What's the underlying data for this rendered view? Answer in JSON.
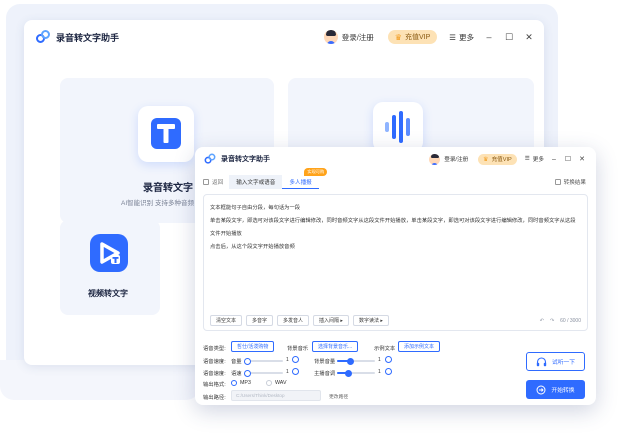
{
  "app": {
    "title": "录音转文字助手"
  },
  "header": {
    "login_label": "登录/注册",
    "vip_label": "充值VIP",
    "more_label": "更多",
    "minimize": "–",
    "maximize": "☐",
    "close": "✕"
  },
  "back_window": {
    "cards": [
      {
        "title": "录音转文字",
        "subtitle": "AI智能识别 支持多种音频"
      },
      {
        "title": ""
      },
      {
        "title": "视频转文字"
      }
    ]
  },
  "front_window": {
    "tabs": {
      "back_label": "返回",
      "input_tab": "输入文字或语音",
      "multi_tab": "多人播报",
      "badge": "实现可购",
      "right_label": "转换结果"
    },
    "editor": {
      "lines": [
        "文本框能句子自由分段，每句话为一段",
        "单击某段文字，即选可对该段文字进行编辑修改，同时音频文字从这段文件开始播放，单击某段文字，即选可对该段文字进行编辑修改，同时音频文字从这段",
        "文件开始播放",
        "点击后，从这个段文字开始播放音频"
      ],
      "tools": [
        "清空文本",
        "多音字",
        "多发音人",
        "插入间隔 ▸",
        "数字读法 ▸"
      ],
      "undo": "↶",
      "redo": "↷",
      "counter": "60 / 3000"
    },
    "settings": {
      "voice_type_label": "语音类型:",
      "voice_type_button": "哲仕/活泼购物",
      "bg_music_label": "背景音乐",
      "bg_music_button": "选择背景音乐...",
      "sample_label": "示例文本",
      "sample_button": "添加示例文本",
      "speed_label": "语音速度:",
      "volume_label": "音量",
      "volume_value": "1",
      "volume_level": 0.05,
      "bg_volume_label": "背景音量",
      "bg_volume_value": "1",
      "bg_volume_level": 0.35,
      "speed2_label": "语音速度:",
      "rate_label": "语速",
      "rate_value": "1",
      "rate_level": 0.05,
      "main_volume_label": "主播音调",
      "main_volume_value": "1",
      "main_volume_level": 0.3,
      "format_label": "输出格式:",
      "format_mp3": "MP3",
      "format_wav": "WAV",
      "format_selected": "MP3",
      "path_label": "输出路径:",
      "path_value": "C:/Users/Think/Desktop",
      "path_change": "更改路径"
    },
    "actions": {
      "preview": "试听一下",
      "convert": "开始转换"
    }
  },
  "colors": {
    "accent": "#2f6bff",
    "vip_bg": "#fde2b5",
    "badge": "#ffa31a"
  },
  "icons": [
    "logo-icon",
    "avatar-icon",
    "crown-icon",
    "menu-icon",
    "text-t-icon",
    "waveform-icon",
    "video-play-icon",
    "headphones-icon",
    "convert-icon"
  ]
}
